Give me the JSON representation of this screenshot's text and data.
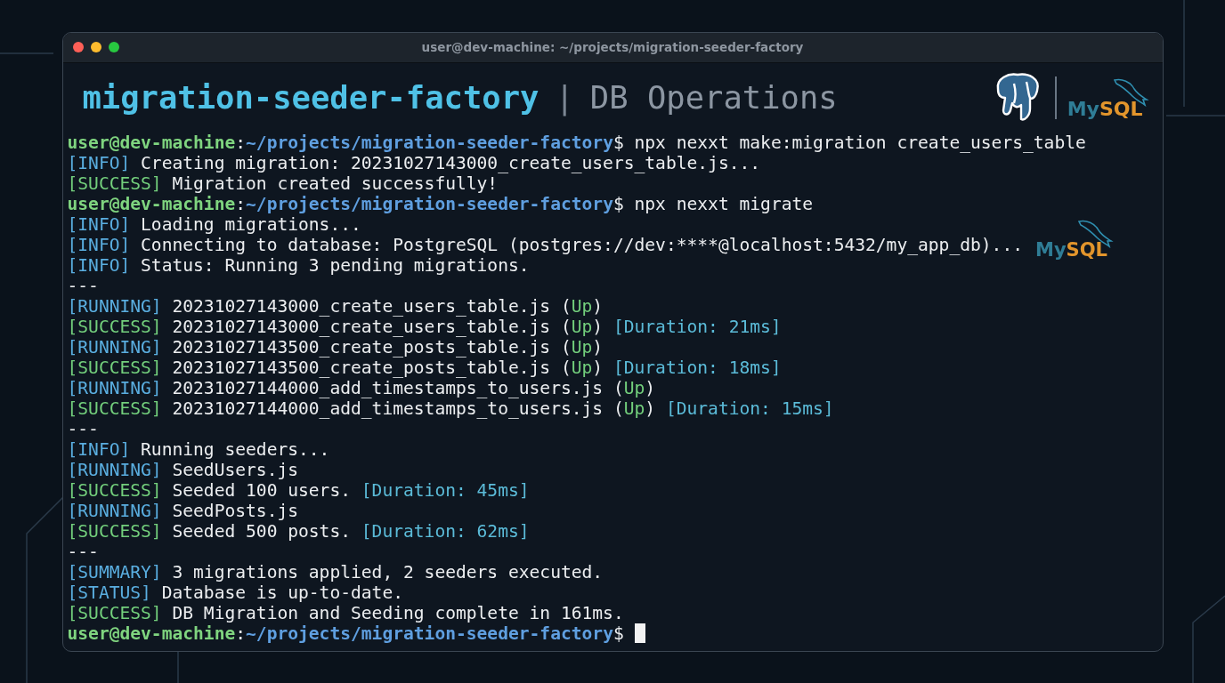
{
  "window": {
    "title": "user@dev-machine: ~/projects/migration-seeder-factory"
  },
  "header": {
    "project": "migration-seeder-factory",
    "separator": "|",
    "subtitle": "DB Operations",
    "logos": [
      {
        "kind": "postgres"
      },
      {
        "kind": "mysql",
        "words": [
          "My",
          "SQL"
        ]
      }
    ]
  },
  "lines": [
    {
      "segments": [
        {
          "kind": "user",
          "text": "user@dev-machine"
        },
        {
          "kind": "text",
          "text": ":"
        },
        {
          "kind": "path",
          "text": "~/projects/migration-seeder-factory"
        },
        {
          "kind": "text",
          "text": "$ npx nexxt make:migration create_users_table"
        }
      ]
    },
    {
      "segments": [
        {
          "kind": "info",
          "text": "[INFO]"
        },
        {
          "kind": "text",
          "text": " Creating migration: 20231027143000_create_users_table.js..."
        }
      ]
    },
    {
      "segments": [
        {
          "kind": "ok",
          "text": "[SUCCESS]"
        },
        {
          "kind": "text",
          "text": " Migration created successfully!"
        }
      ]
    },
    {
      "segments": [
        {
          "kind": "user",
          "text": "user@dev-machine"
        },
        {
          "kind": "text",
          "text": ":"
        },
        {
          "kind": "path",
          "text": "~/projects/migration-seeder-factory"
        },
        {
          "kind": "text",
          "text": "$ npx nexxt migrate"
        }
      ]
    },
    {
      "segments": [
        {
          "kind": "info",
          "text": "[INFO]"
        },
        {
          "kind": "text",
          "text": " Loading migrations..."
        }
      ]
    },
    {
      "segments": [
        {
          "kind": "info",
          "text": "[INFO]"
        },
        {
          "kind": "text",
          "text": " Connecting to database: PostgreSQL (postgres://dev:****@localhost:5432/my_app_db)..."
        }
      ],
      "logo": {
        "kind": "mysql",
        "words": [
          "My",
          "SQL"
        ]
      }
    },
    {
      "segments": [
        {
          "kind": "info",
          "text": "[INFO]"
        },
        {
          "kind": "text",
          "text": " Status: Running 3 pending migrations."
        }
      ]
    },
    {
      "segments": [
        {
          "kind": "text",
          "text": "---"
        }
      ]
    },
    {
      "segments": [
        {
          "kind": "info",
          "text": "[RUNNING]"
        },
        {
          "kind": "text",
          "text": " 20231027143000_create_users_table.js ("
        },
        {
          "kind": "ok",
          "text": "Up"
        },
        {
          "kind": "text",
          "text": ")"
        }
      ]
    },
    {
      "segments": [
        {
          "kind": "ok",
          "text": "[SUCCESS]"
        },
        {
          "kind": "text",
          "text": " 20231027143000_create_users_table.js ("
        },
        {
          "kind": "ok",
          "text": "Up"
        },
        {
          "kind": "text",
          "text": ") "
        },
        {
          "kind": "dur",
          "text": "[Duration: 21ms]"
        }
      ]
    },
    {
      "segments": [
        {
          "kind": "info",
          "text": "[RUNNING]"
        },
        {
          "kind": "text",
          "text": " 20231027143500_create_posts_table.js ("
        },
        {
          "kind": "ok",
          "text": "Up"
        },
        {
          "kind": "text",
          "text": ")"
        }
      ]
    },
    {
      "segments": [
        {
          "kind": "ok",
          "text": "[SUCCESS]"
        },
        {
          "kind": "text",
          "text": " 20231027143500_create_posts_table.js ("
        },
        {
          "kind": "ok",
          "text": "Up"
        },
        {
          "kind": "text",
          "text": ") "
        },
        {
          "kind": "dur",
          "text": "[Duration: 18ms]"
        }
      ]
    },
    {
      "segments": [
        {
          "kind": "info",
          "text": "[RUNNING]"
        },
        {
          "kind": "text",
          "text": " 20231027144000_add_timestamps_to_users.js ("
        },
        {
          "kind": "ok",
          "text": "Up"
        },
        {
          "kind": "text",
          "text": ")"
        }
      ]
    },
    {
      "segments": [
        {
          "kind": "ok",
          "text": "[SUCCESS]"
        },
        {
          "kind": "text",
          "text": " 20231027144000_add_timestamps_to_users.js ("
        },
        {
          "kind": "ok",
          "text": "Up"
        },
        {
          "kind": "text",
          "text": ") "
        },
        {
          "kind": "dur",
          "text": "[Duration: 15ms]"
        }
      ]
    },
    {
      "segments": [
        {
          "kind": "text",
          "text": "---"
        }
      ]
    },
    {
      "segments": [
        {
          "kind": "info",
          "text": "[INFO]"
        },
        {
          "kind": "text",
          "text": " Running seeders..."
        }
      ]
    },
    {
      "segments": [
        {
          "kind": "info",
          "text": "[RUNNING]"
        },
        {
          "kind": "text",
          "text": " SeedUsers.js"
        }
      ]
    },
    {
      "segments": [
        {
          "kind": "ok",
          "text": "[SUCCESS]"
        },
        {
          "kind": "text",
          "text": " Seeded 100 users. "
        },
        {
          "kind": "dur",
          "text": "[Duration: 45ms]"
        }
      ]
    },
    {
      "segments": [
        {
          "kind": "info",
          "text": "[RUNNING]"
        },
        {
          "kind": "text",
          "text": " SeedPosts.js"
        }
      ]
    },
    {
      "segments": [
        {
          "kind": "ok",
          "text": "[SUCCESS]"
        },
        {
          "kind": "text",
          "text": " Seeded 500 posts. "
        },
        {
          "kind": "dur",
          "text": "[Duration: 62ms]"
        }
      ]
    },
    {
      "segments": [
        {
          "kind": "text",
          "text": "---"
        }
      ]
    },
    {
      "segments": [
        {
          "kind": "info",
          "text": "[SUMMARY]"
        },
        {
          "kind": "text",
          "text": " 3 migrations applied, 2 seeders executed."
        }
      ]
    },
    {
      "segments": [
        {
          "kind": "info",
          "text": "[STATUS]"
        },
        {
          "kind": "text",
          "text": " Database is up-to-date."
        }
      ]
    },
    {
      "segments": [
        {
          "kind": "ok",
          "text": "[SUCCESS]"
        },
        {
          "kind": "text",
          "text": " DB Migration and Seeding complete in 161ms."
        }
      ]
    },
    {
      "segments": [
        {
          "kind": "user",
          "text": "user@dev-machine"
        },
        {
          "kind": "text",
          "text": ":"
        },
        {
          "kind": "path",
          "text": "~/projects/migration-seeder-factory"
        },
        {
          "kind": "text",
          "text": "$ "
        }
      ],
      "cursor": true
    }
  ]
}
